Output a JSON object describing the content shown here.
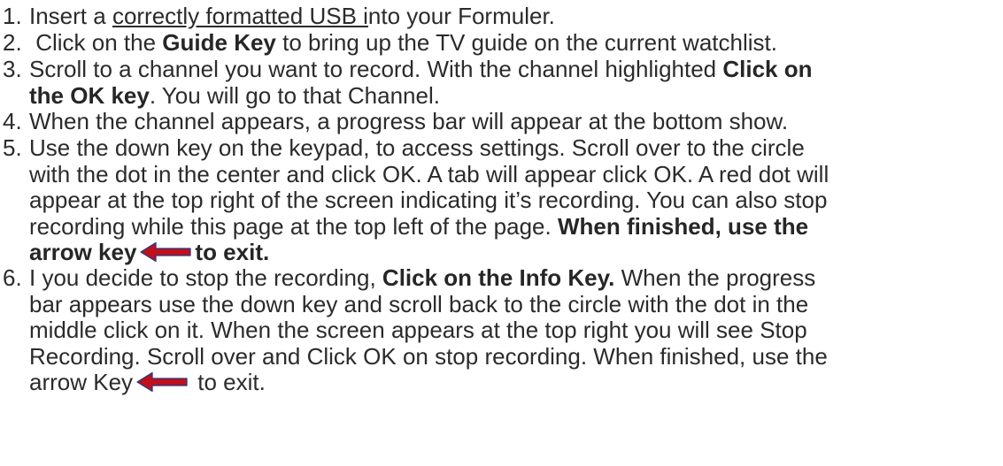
{
  "steps": [
    {
      "number": "1.",
      "lines": [
        [
          {
            "text": "Insert a "
          },
          {
            "text": "correctly formatted USB i",
            "link": true
          },
          {
            "text": "nto your Formuler."
          }
        ]
      ]
    },
    {
      "number": "2.",
      "lines": [
        [
          {
            "text": " Click on the "
          },
          {
            "text": "Guide Key",
            "bold": true
          },
          {
            "text": " to bring up the TV guide on the current watchlist."
          }
        ]
      ]
    },
    {
      "number": "3.",
      "lines": [
        [
          {
            "text": "Scroll to a channel you want to record. With the channel highlighted "
          },
          {
            "text": "Click on",
            "bold": true
          }
        ],
        [
          {
            "text": "the OK key",
            "bold": true
          },
          {
            "text": ". You will go to that Channel."
          }
        ]
      ]
    },
    {
      "number": "4.",
      "lines": [
        [
          {
            "text": "When the channel appears, a progress bar will appear at the bottom show."
          }
        ]
      ]
    },
    {
      "number": "5.",
      "lines": [
        [
          {
            "text": "Use the down key on the keypad, to access settings. Scroll over to the circle"
          }
        ],
        [
          {
            "text": "with the dot in the center and click OK. A tab will appear click OK. A red dot will"
          }
        ],
        [
          {
            "text": "appear at the top right of the screen indicating it’s recording. You can also stop"
          }
        ],
        [
          {
            "text": "recording while this page at the top left of the page. "
          },
          {
            "text": "When finished, use the",
            "bold": true
          }
        ],
        [
          {
            "text": "arrow key",
            "bold": true
          },
          {
            "arrow": true
          },
          {
            "text": "to exit.",
            "bold": true
          }
        ]
      ]
    },
    {
      "number": "6.",
      "lines": [
        [
          {
            "text": "I you decide to stop the recording, "
          },
          {
            "text": "Click on the Info Key.",
            "bold": true
          },
          {
            "text": " When the progress"
          }
        ],
        [
          {
            "text": "bar appears use the down key and scroll back to the circle with the dot in the"
          }
        ],
        [
          {
            "text": "middle click on it. When the screen appears at the top right you will see Stop"
          }
        ],
        [
          {
            "text": "Recording. Scroll over and Click OK on stop recording. When finished, use the"
          }
        ],
        [
          {
            "text": "arrow Key"
          },
          {
            "arrow": true
          },
          {
            "text": " to exit."
          }
        ]
      ]
    }
  ],
  "colors": {
    "text": "#2b2b2b",
    "arrow_fill": "#c0101a",
    "arrow_outline": "#1f3b8a"
  },
  "icons": {
    "arrow": "left-arrow-icon"
  }
}
